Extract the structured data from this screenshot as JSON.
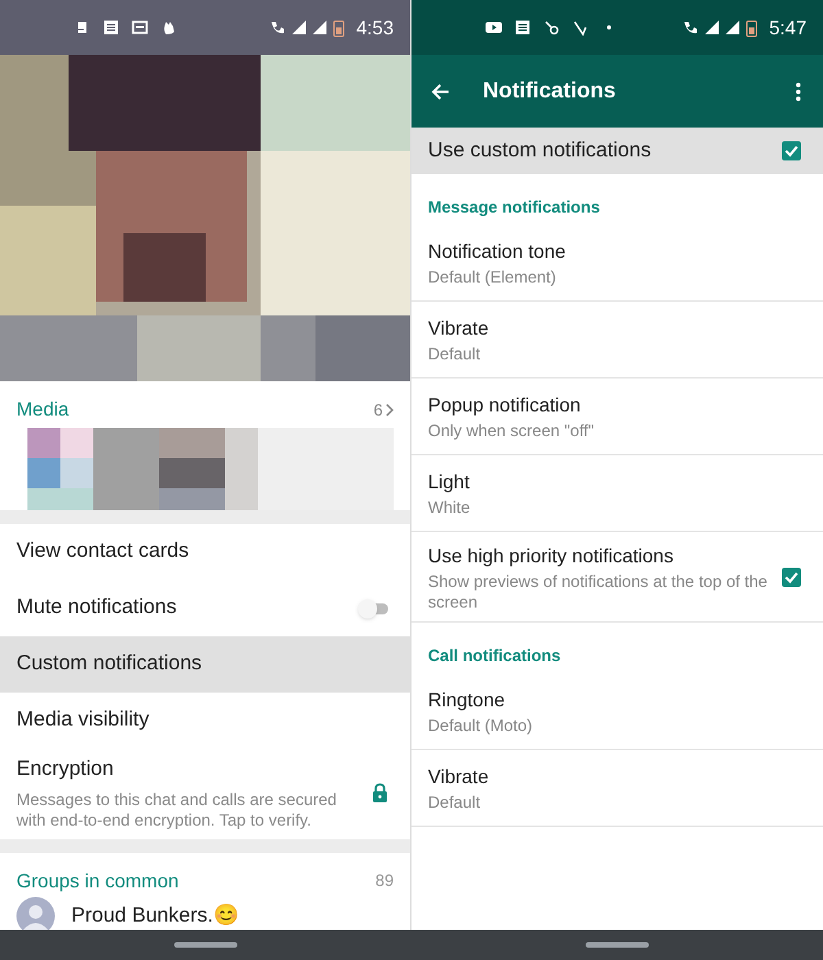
{
  "left": {
    "status_bar": {
      "time": "4:53"
    },
    "media": {
      "title": "Media",
      "count": "6"
    },
    "items": [
      {
        "kind": "plain",
        "label": "View contact cards",
        "selected": false
      },
      {
        "kind": "toggle",
        "label": "Mute notifications",
        "on": false,
        "selected": false
      },
      {
        "kind": "plain",
        "label": "Custom notifications",
        "selected": true
      },
      {
        "kind": "plain",
        "label": "Media visibility",
        "selected": false
      },
      {
        "kind": "lock",
        "label": "Encryption",
        "subtitle": "Messages to this chat and calls are secured with end-to-end encryption. Tap to verify.",
        "selected": false
      }
    ],
    "groups": {
      "title": "Groups in common",
      "count": "89",
      "items": [
        {
          "name": "Proud Bunkers.😊"
        }
      ]
    }
  },
  "right": {
    "status_bar": {
      "time": "5:47"
    },
    "toolbar": {
      "title": "Notifications"
    },
    "custom": {
      "label": "Use custom notifications",
      "checked": true,
      "selected": true
    },
    "sections": [
      {
        "title": "Message notifications",
        "items": [
          {
            "kind": "pref",
            "label": "Notification tone",
            "value": "Default (Element)"
          },
          {
            "kind": "pref",
            "label": "Vibrate",
            "value": "Default"
          },
          {
            "kind": "pref",
            "label": "Popup notification",
            "value": "Only when screen \"off\""
          },
          {
            "kind": "pref",
            "label": "Light",
            "value": "White"
          },
          {
            "kind": "checkbox",
            "label": "Use high priority notifications",
            "value": "Show previews of notifications at the top of the screen",
            "checked": true
          }
        ]
      },
      {
        "title": "Call notifications",
        "items": [
          {
            "kind": "pref",
            "label": "Ringtone",
            "value": "Default (Moto)"
          },
          {
            "kind": "pref",
            "label": "Vibrate",
            "value": "Default"
          }
        ]
      }
    ]
  }
}
